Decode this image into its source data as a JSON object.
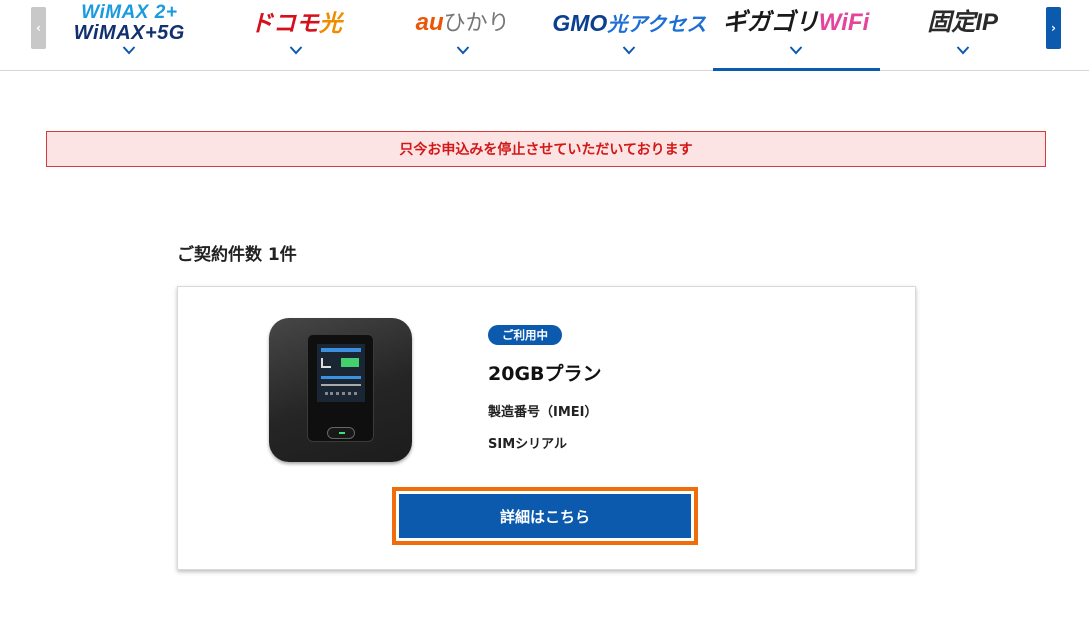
{
  "nav": {
    "prev_arrow": "‹",
    "next_arrow": "›",
    "tabs": [
      {
        "line1": "WiMAX 2+",
        "line2": "WiMAX+5G"
      },
      {
        "main": "ドコモ",
        "accent": "光"
      },
      {
        "main": "au",
        "rest": "ひかり"
      },
      {
        "main": "GMO",
        "sub": "光アクセス"
      },
      {
        "main": "ギガゴリ",
        "accent": "WiFi"
      },
      {
        "main": "固定IP"
      }
    ],
    "active_tab": "ギガゴリWiFi",
    "accent_color": "#0b5aae"
  },
  "alert": {
    "message": "只今お申込みを停止させていただいております",
    "color": "#d21818"
  },
  "contracts": {
    "count_label": "ご契約件数 1件",
    "card": {
      "status": "ご利用中",
      "plan": "20GBプラン",
      "imei_label": "製造番号（IMEI）",
      "sim_label": "SIMシリアル",
      "detail_button": "詳細はこちら",
      "highlight_color": "#ef6d0a"
    }
  }
}
